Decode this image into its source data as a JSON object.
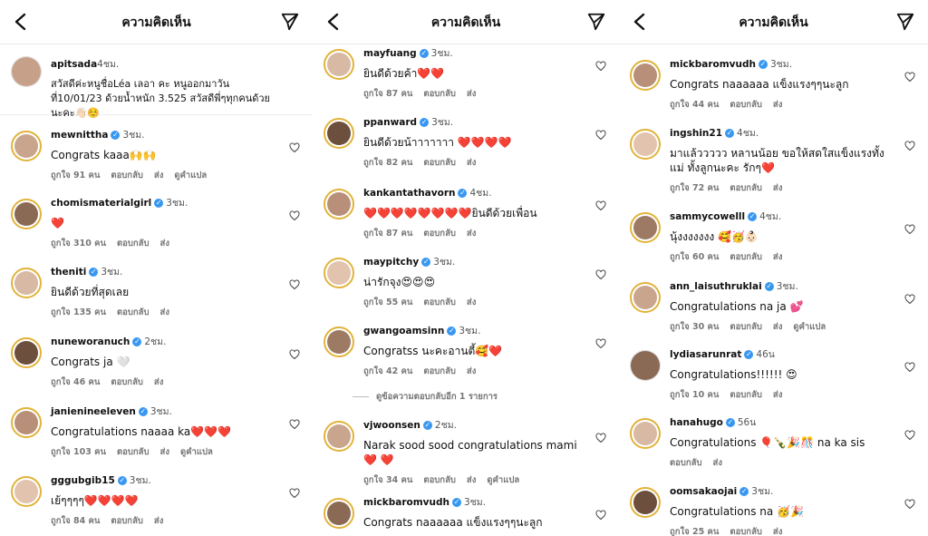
{
  "header_title": "ความคิดเห็น",
  "labels": {
    "like_suffix": "คน",
    "reply": "ตอบกลับ",
    "send": "ส่ง",
    "translate": "ดูคำแปล"
  },
  "panel1": {
    "caption": {
      "user": "apitsada",
      "time": "4ชม.",
      "text": "สวัสดีค่ะหนูชื่อLéa เลอา คะ หนูออกมาวันที่10/01/23 ด้วยน้ำหนัก 3.525 สวัสดีพี่ๆทุกคนด้วยนะคะ👋🏻☺️"
    },
    "comments": [
      {
        "user": "mewnittha",
        "time": "3ชม.",
        "text": "Congrats kaaa🙌🙌",
        "likes": "ถูกใจ 91 คน"
      },
      {
        "user": "chomismaterialgirl",
        "time": "3ชม.",
        "text": "❤️",
        "likes": "ถูกใจ 310 คน"
      },
      {
        "user": "theniti",
        "time": "3ชม.",
        "text": "ยินดีด้วยที่สุดเลย",
        "likes": "ถูกใจ 135 คน"
      },
      {
        "user": "nuneworanuch",
        "time": "2ชม.",
        "text": "Congrats ja 🤍",
        "likes": "ถูกใจ 46 คน"
      },
      {
        "user": "janienineeleven",
        "time": "3ชม.",
        "text": "Congratulations naaaa ka❤️❤️❤️",
        "likes": "ถูกใจ 103 คน"
      },
      {
        "user": "gggubgib15",
        "time": "3ชม.",
        "text": "เย้ๆๆๆๆ❤️❤️❤️❤️",
        "likes": "ถูกใจ 84 คน"
      }
    ]
  },
  "panel2": {
    "comments": [
      {
        "user": "mayfuang",
        "time": "3ชม.",
        "text": "ยินดีด้วยค้า❤️❤️",
        "likes": "ถูกใจ 87 คน"
      },
      {
        "user": "ppanward",
        "time": "3ชม.",
        "text": "ยินดีด้วยน้าาาาาาา ❤️❤️❤️❤️",
        "likes": "ถูกใจ 82 คน"
      },
      {
        "user": "kankantathavorn",
        "time": "4ชม.",
        "text": "❤️❤️❤️❤️❤️❤️❤️❤️ยินดีด้วยเพื่อน",
        "likes": "ถูกใจ 87 คน"
      },
      {
        "user": "maypitchy",
        "time": "3ชม.",
        "text": "น่ารักจุง😍😍😍",
        "likes": "ถูกใจ 55 คน"
      },
      {
        "user": "gwangoamsinn",
        "time": "3ชม.",
        "text": "Congratss นะคะอานตี้🥰❤️",
        "likes": "ถูกใจ 42 คน"
      },
      {
        "user": "vjwoonsen",
        "time": "2ชม.",
        "text": "Narak sood sood congratulations mami❤️ ❤️",
        "likes": "ถูกใจ 34 คน"
      },
      {
        "user": "mickbaromvudh",
        "time": "3ชม.",
        "text": "Congrats naaaaaa แข็งแรงๆๆนะลูก",
        "likes": ""
      }
    ],
    "view_more": "ดูข้อความตอบกลับอีก 1 รายการ"
  },
  "panel3": {
    "comments": [
      {
        "user": "mickbaromvudh",
        "time": "3ชม.",
        "text": "Congrats naaaaaa แข็งแรงๆๆนะลูก",
        "likes": "ถูกใจ 44 คน"
      },
      {
        "user": "ingshin21",
        "time": "4ชม.",
        "text": "มาแล้ววววว หลานน้อย ขอให้สดใสแข็งแรงทั้งแม่ ทั้งลูกนะคะ รักๆ❤️",
        "likes": "ถูกใจ 72 คน"
      },
      {
        "user": "sammycowelll",
        "time": "4ชม.",
        "text": "นุ้งงงงงงง 🥰🥳👶🏻",
        "likes": "ถูกใจ 60 คน"
      },
      {
        "user": "ann_laisuthruklai",
        "time": "3ชม.",
        "text": "Congratulations na ja 💕",
        "likes": "ถูกใจ 30 คน"
      },
      {
        "user": "lydiasarunrat",
        "time": "46น",
        "text": "Congratulations!!!!!! 😍",
        "likes": "ถูกใจ 10 คน"
      },
      {
        "user": "hanahugo",
        "time": "56น",
        "text": "Congratulations 🎈🍾🎉🎊 na ka sis",
        "likes": ""
      },
      {
        "user": "oomsakaojai",
        "time": "3ชม.",
        "text": "Congratulations na 🥳🎉",
        "likes": "ถูกใจ 25 คน"
      }
    ]
  },
  "colors": {
    "story_ring": "#e1b33a",
    "verified": "#3897f0"
  },
  "icons": {
    "back": "chevron-left-icon",
    "send": "paper-plane-icon",
    "like": "heart-outline-icon",
    "verified": "verified-badge-icon"
  }
}
